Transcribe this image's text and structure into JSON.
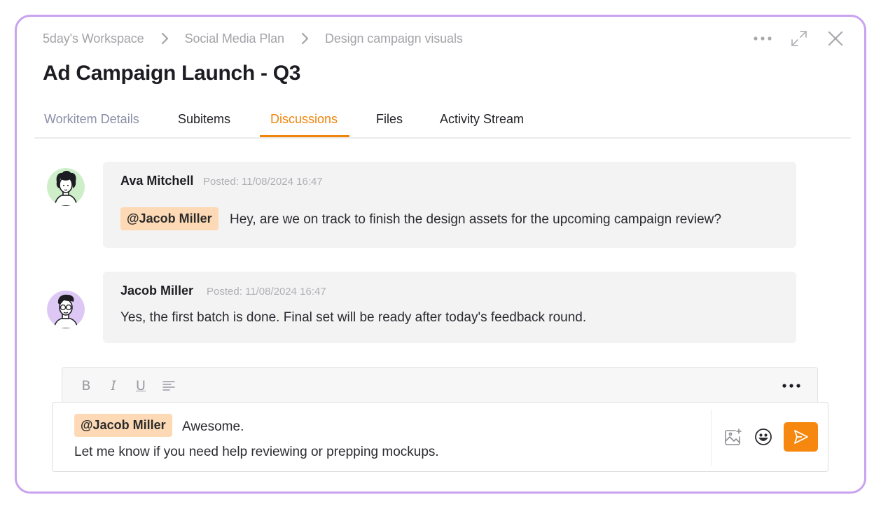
{
  "breadcrumb": [
    "5day's Workspace",
    "Social Media Plan",
    "Design campaign visuals"
  ],
  "page_title": "Ad Campaign Launch - Q3",
  "tabs": [
    {
      "label": "Workitem Details",
      "state": "muted"
    },
    {
      "label": "Subitems",
      "state": "normal"
    },
    {
      "label": "Discussions",
      "state": "active"
    },
    {
      "label": "Files",
      "state": "normal"
    },
    {
      "label": "Activity Stream",
      "state": "normal"
    }
  ],
  "messages": [
    {
      "author": "Ava Mitchell",
      "posted": "Posted: 11/08/2024 16:47",
      "mention": "@Jacob Miller",
      "text": "Hey, are we on track to finish the design assets for the upcoming campaign review?",
      "avatar": "avatar-curly-hair-green"
    },
    {
      "author": "Jacob Miller",
      "posted": "Posted: 11/08/2024 16:47",
      "text": "Yes, the first batch is done. Final set will be ready after today's feedback round.",
      "avatar": "avatar-glasses-purple"
    }
  ],
  "editor": {
    "toolbar": {
      "bold": "B",
      "italic": "I",
      "underline": "U",
      "align_icon": "align-left-icon",
      "more_icon": "more-horizontal-icon"
    },
    "mention": "@Jacob Miller",
    "line1": "Awesome.",
    "line2": "Let me know if you need help reviewing or prepping mockups.",
    "image_icon": "add-image-icon",
    "emoji_icon": "emoji-icon",
    "send_icon": "send-icon"
  },
  "colors": {
    "accent": "#f0850c",
    "frame_border": "#c9a3ef",
    "mention_bg": "#fdd9b5",
    "card_bg": "#f3f3f4"
  }
}
